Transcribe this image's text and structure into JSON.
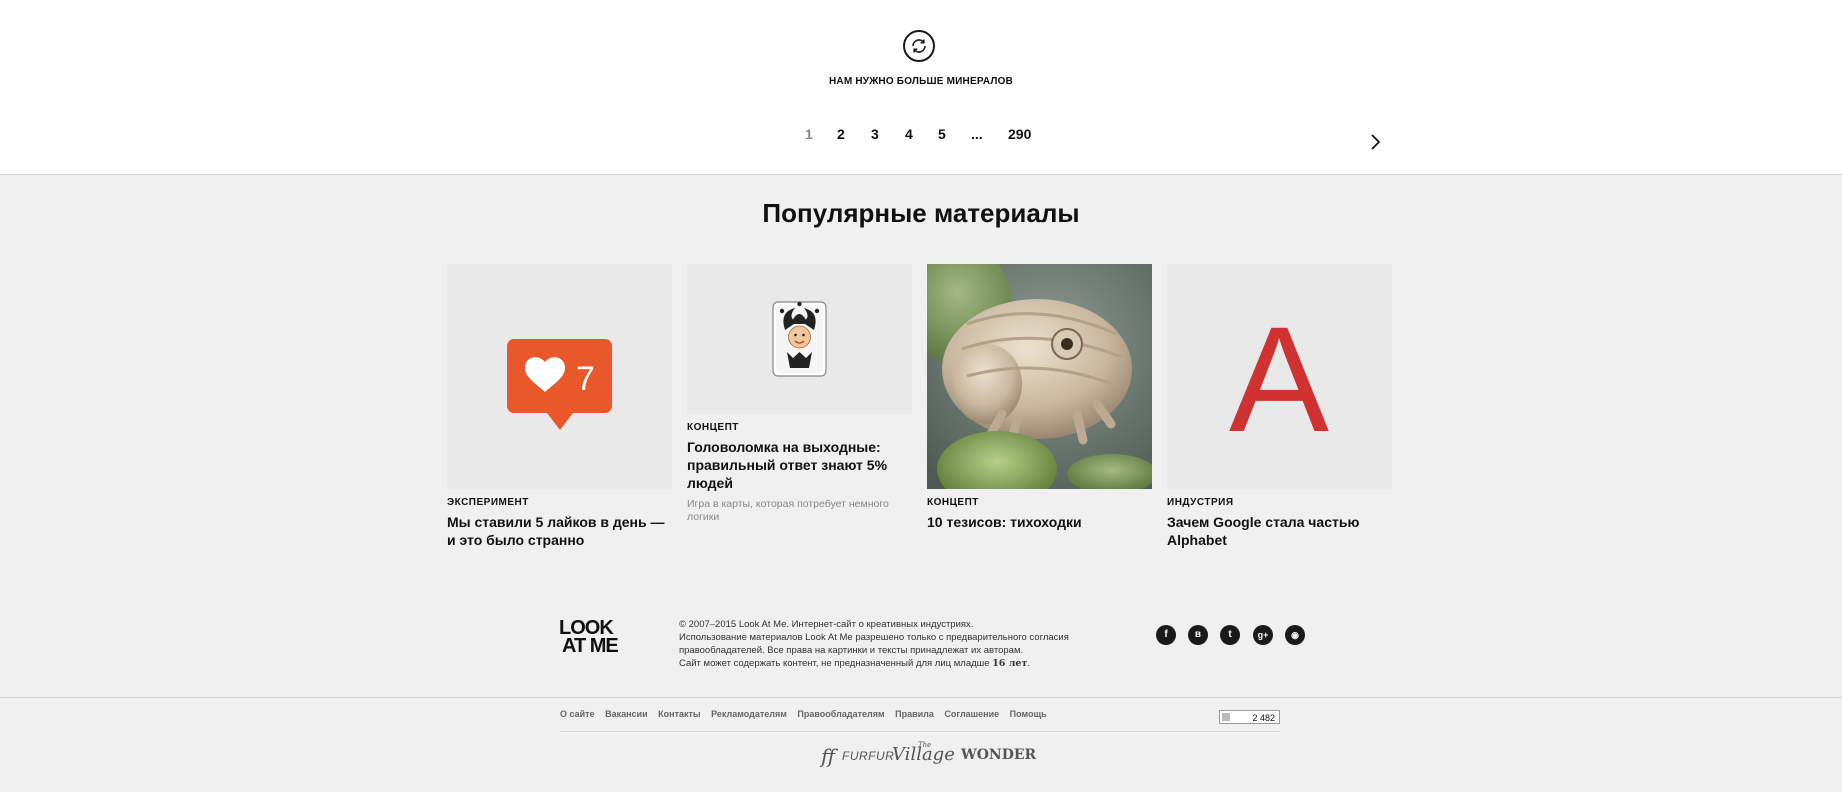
{
  "load_more": {
    "icon": "refresh-icon",
    "label": "НАМ НУЖНО БОЛЬШЕ МИНЕРАЛОВ"
  },
  "pagination": {
    "pages": [
      "1",
      "2",
      "3",
      "4",
      "5",
      "...",
      "290"
    ],
    "current": "1",
    "next_icon": "chevron-right-icon"
  },
  "popular": {
    "title": "Популярные материалы",
    "cards": [
      {
        "kicker": "ЭКСПЕРИМЕНТ",
        "headline": "Мы ставили 5 лайков в день — и это было странно",
        "image": "like-notification-icon",
        "like_count": "7"
      },
      {
        "kicker": "КОНЦЕПТ",
        "headline": "Головоломка на выходные: правильный ответ знают 5% людей",
        "lead": "Игра в карты, которая потребует немного логики",
        "image": "joker-card-icon"
      },
      {
        "kicker": "КОНЦЕПТ",
        "headline": "10 тезисов: тихоходки",
        "image": "tardigrade-photo"
      },
      {
        "kicker": "ИНДУСТРИЯ",
        "headline": "Зачем Google стала частью Alphabet",
        "image": "alphabet-logo",
        "image_letter": "A"
      }
    ]
  },
  "footer": {
    "logo_line1": "LOOK",
    "logo_line2": "AT ME",
    "copyright": {
      "line1": "© 2007–2015 Look At Me. Интернет-сайт о креативных индустриях.",
      "line2": "Использование материалов Look At Me разрешено только с предварительного согласия",
      "line3": "правообладателей. Все права на картинки и тексты принадлежат их авторам.",
      "line4": "Сайт может содержать контент, не предназначенный для лиц младше",
      "age": "16 лет",
      "dot": "."
    },
    "socials": [
      {
        "icon": "facebook-icon",
        "glyph": "f"
      },
      {
        "icon": "vkontakte-icon",
        "glyph": "в"
      },
      {
        "icon": "twitter-icon",
        "glyph": "t"
      },
      {
        "icon": "google-plus-icon",
        "glyph": "g+"
      },
      {
        "icon": "rss-icon",
        "glyph": "◉"
      }
    ],
    "links": [
      "О сайте",
      "Вакансии",
      "Контакты",
      "Рекламодателям",
      "Правообладателям",
      "Правила",
      "Соглашение",
      "Помощь"
    ],
    "counter": "2 482",
    "partners": [
      "FURFUR",
      "Village",
      "The",
      "WONDER"
    ]
  },
  "colors": {
    "like_orange": "#e8582a",
    "alphabet_red": "#d03232",
    "text": "#111111",
    "muted": "#888888",
    "background": "#f0f0f0"
  }
}
